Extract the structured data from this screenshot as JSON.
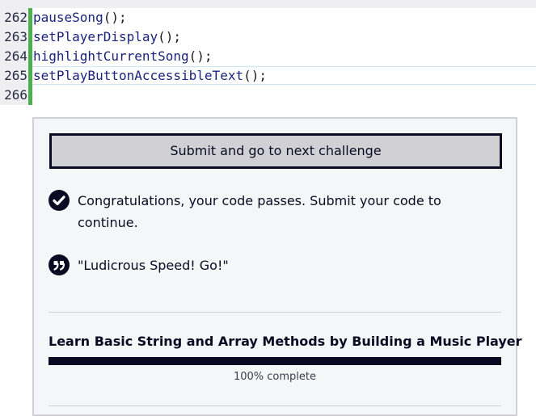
{
  "editor": {
    "lines": [
      {
        "number": "262",
        "code": "pauseSong",
        "punc": "();"
      },
      {
        "number": "263",
        "code": "setPlayerDisplay",
        "punc": "();"
      },
      {
        "number": "264",
        "code": "highlightCurrentSong",
        "punc": "();"
      },
      {
        "number": "265",
        "code": "setPlayButtonAccessibleText",
        "punc": "();"
      },
      {
        "number": "266",
        "code": "",
        "punc": ""
      }
    ],
    "gutter_color": "#4caf50"
  },
  "panel": {
    "submit_label": "Submit and go to next challenge",
    "success_message": "Congratulations, your code passes. Submit your code to continue.",
    "success_icon": "check-circle-icon",
    "quote": "\"Ludicrous Speed! Go!\"",
    "quote_icon": "quote-icon",
    "course_title": "Learn Basic String and Array Methods by Building a Music Player",
    "progress_percent": 100,
    "progress_label": "100% complete"
  },
  "colors": {
    "accent_dark": "#0a0a23",
    "button_bg": "#d0d0d5"
  }
}
